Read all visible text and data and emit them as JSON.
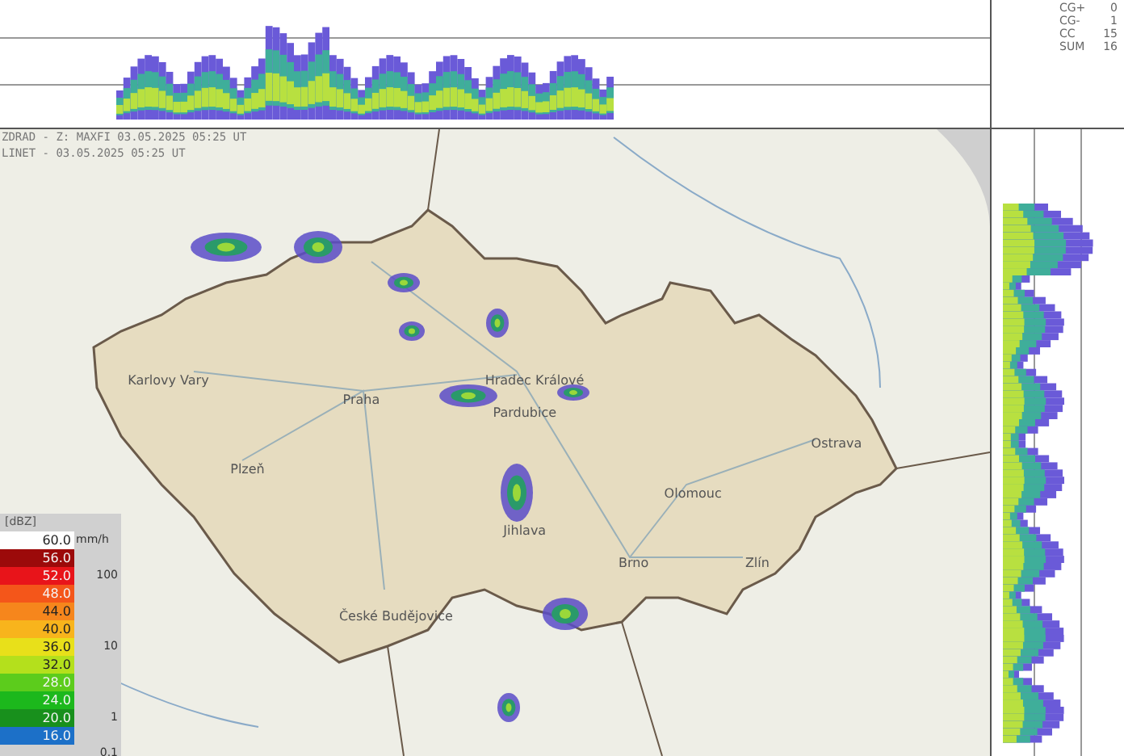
{
  "header_lines": [
    "ZDRAD - Z: MAXFI 03.05.2025 05:25 UT",
    "LINET - 03.05.2025 05:25 UT"
  ],
  "lightning_stats": [
    {
      "label": "CG+",
      "value": "0"
    },
    {
      "label": "CG-",
      "value": "1"
    },
    {
      "label": "CC",
      "value": "15"
    },
    {
      "label": "SUM",
      "value": "16"
    }
  ],
  "cities": [
    "Karlovy Vary",
    "Praha",
    "Plzeň",
    "Hradec Králové",
    "Pardubice",
    "Jihlava",
    "Olomouc",
    "Ostrava",
    "Brno",
    "Zlín",
    "České Budějovice"
  ],
  "legend": {
    "unit": "[dBZ]",
    "rate_unit": "mm/h",
    "rows": [
      {
        "value": "60.0",
        "color": "#ffffff"
      },
      {
        "value": "56.0",
        "color": "#9c0a0a"
      },
      {
        "value": "52.0",
        "color": "#e8141a"
      },
      {
        "value": "48.0",
        "color": "#f4561a"
      },
      {
        "value": "44.0",
        "color": "#f6861c"
      },
      {
        "value": "40.0",
        "color": "#f8b41c"
      },
      {
        "value": "36.0",
        "color": "#e8e01a"
      },
      {
        "value": "32.0",
        "color": "#b4e01c"
      },
      {
        "value": "28.0",
        "color": "#5ccc1c"
      },
      {
        "value": "24.0",
        "color": "#1cb81c"
      },
      {
        "value": "20.0",
        "color": "#18901c"
      },
      {
        "value": "16.0",
        "color": "#1c70c8"
      }
    ],
    "rate_marks": [
      "100",
      "10",
      "1",
      "0.1"
    ]
  }
}
